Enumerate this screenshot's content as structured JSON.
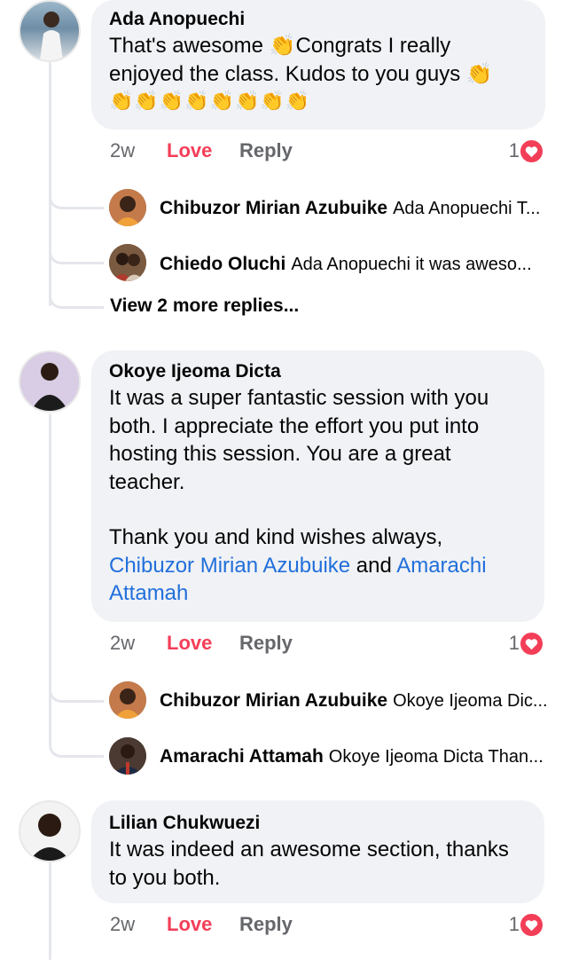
{
  "comments": [
    {
      "author": "Ada Anopuechi",
      "text": "That's awesome 👏Congrats I really enjoyed the class. Kudos to you guys 👏",
      "emoji_line": "👏👏👏👏👏👏👏👏",
      "time": "2w",
      "love": "Love",
      "reply": "Reply",
      "reaction_count": "1",
      "replies": [
        {
          "name": "Chibuzor Mirian Azubuike",
          "snippet": "Ada Anopuechi T..."
        },
        {
          "name": "Chiedo Oluchi",
          "snippet": "Ada Anopuechi it was aweso..."
        }
      ],
      "more_replies": "View 2 more replies..."
    },
    {
      "author": "Okoye Ijeoma Dicta",
      "text": "It was a super fantastic session with you both. I appreciate the effort you put into hosting this session. You are a great teacher.",
      "text2": "Thank you and kind wishes always,",
      "mention1": "Chibuzor Mirian Azubuike",
      "and": " and ",
      "mention2": "Amarachi Attamah",
      "time": "2w",
      "love": "Love",
      "reply": "Reply",
      "reaction_count": "1",
      "replies": [
        {
          "name": "Chibuzor Mirian Azubuike",
          "snippet": "Okoye Ijeoma Dic..."
        },
        {
          "name": "Amarachi Attamah",
          "snippet": "Okoye Ijeoma Dicta Than..."
        }
      ]
    },
    {
      "author": "Lilian Chukwuezi",
      "text": "It was indeed an awesome section, thanks to you both.",
      "time": "2w",
      "love": "Love",
      "reply": "Reply",
      "reaction_count": "1"
    }
  ],
  "colors": {
    "love": "#f33e58",
    "mention": "#216fdb",
    "bubble": "#f0f2f5"
  }
}
